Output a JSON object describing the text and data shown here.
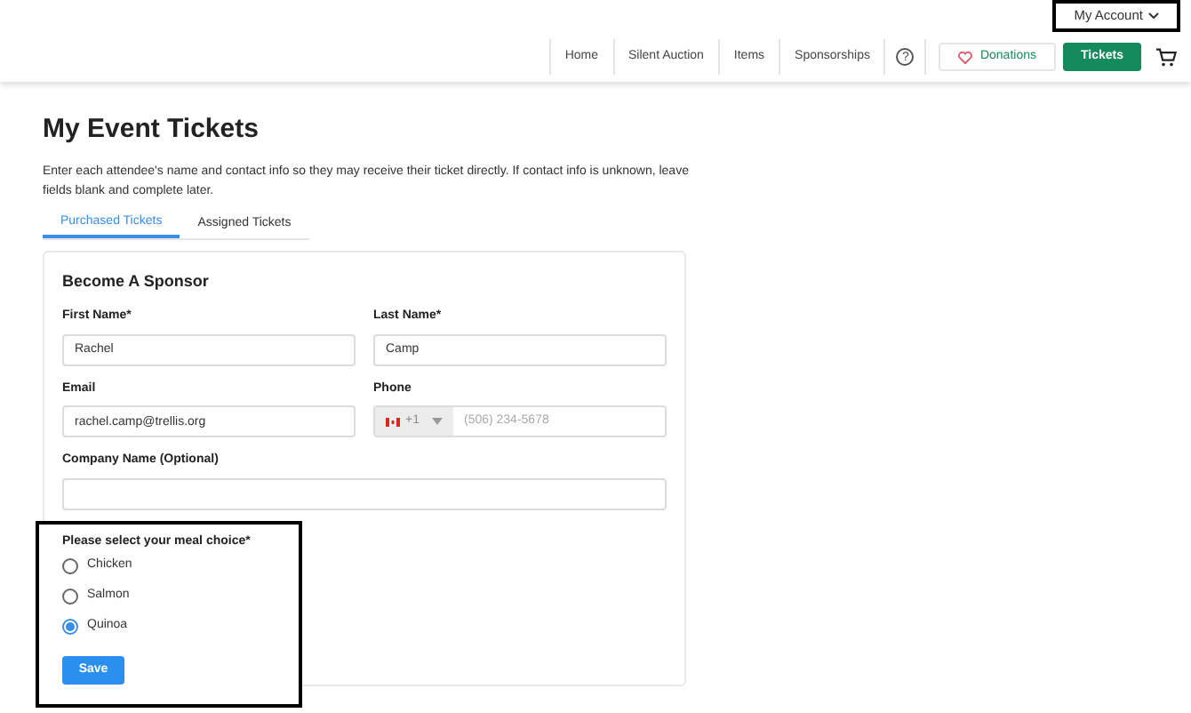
{
  "account_menu": {
    "label": "My Account"
  },
  "nav": {
    "links": [
      "Home",
      "Silent Auction",
      "Items",
      "Sponsorships"
    ],
    "help": "?",
    "donate": "Donations",
    "tickets": "Tickets"
  },
  "page": {
    "title": "My Event Tickets",
    "intro": "Enter each attendee's name and contact info so they may receive their ticket directly. If contact info is unknown, leave fields blank and complete later."
  },
  "tabs": [
    {
      "label": "Purchased Tickets",
      "selected": true
    },
    {
      "label": "Assigned Tickets",
      "selected": false
    }
  ],
  "form": {
    "title": "Become A Sponsor",
    "fields": [
      {
        "label": "First Name*",
        "value": "Rachel"
      },
      {
        "label": "Last Name*",
        "value": "Camp"
      },
      {
        "label": "Email",
        "value": "rachel.camp@trellis.org"
      },
      {
        "label": "Phone",
        "code": "+1",
        "placeholder": "(506) 234-5678",
        "kind": "phone"
      },
      {
        "label": "Company Name (Optional)",
        "kind": "wide"
      }
    ],
    "meal": {
      "label": "Please select your meal choice*",
      "options": [
        {
          "label": "Chicken",
          "selected": false
        },
        {
          "label": "Salmon",
          "selected": false
        },
        {
          "label": "Quinoa",
          "selected": true
        }
      ]
    },
    "save": "Save"
  }
}
